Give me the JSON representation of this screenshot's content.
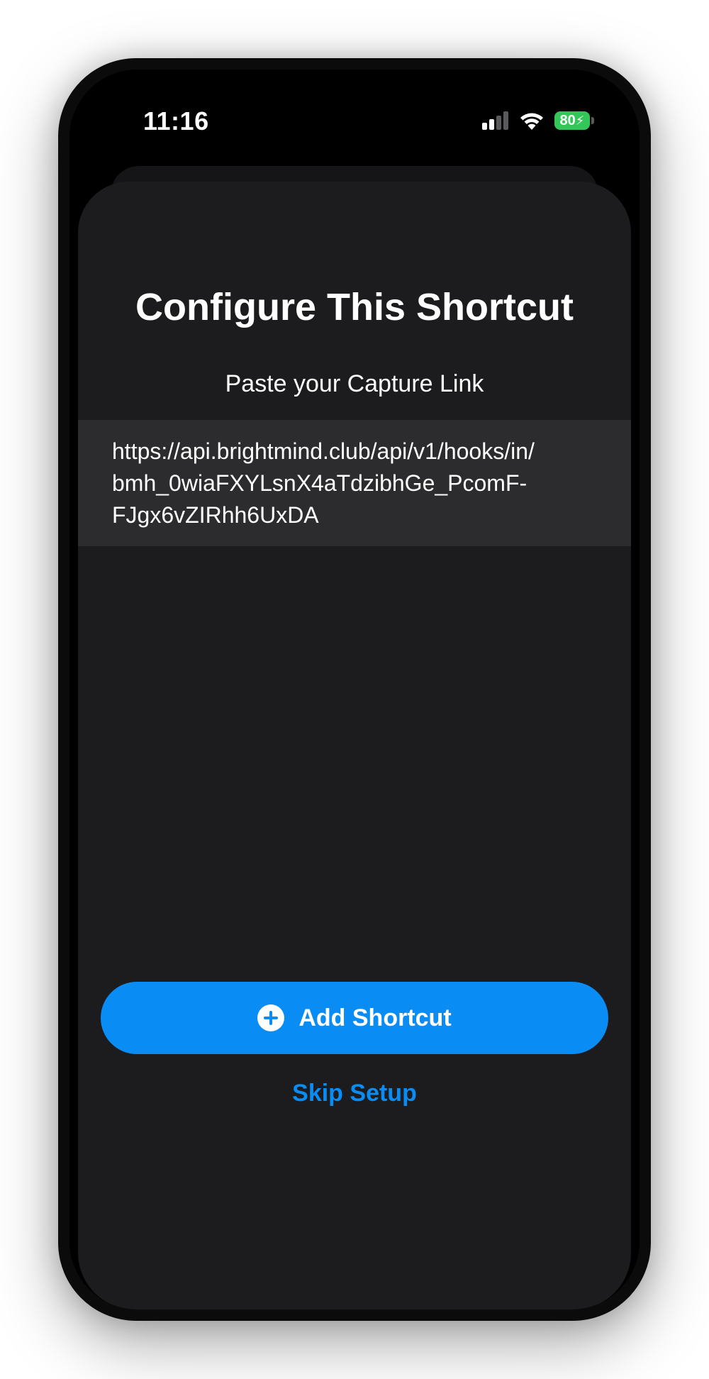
{
  "status_bar": {
    "time": "11:16",
    "battery_level": "80",
    "signal_icon": "cellular-signal-icon",
    "wifi_icon": "wifi-icon",
    "battery_icon": "battery-charging-icon",
    "battery_color": "#33c759"
  },
  "sheet": {
    "title": "Configure This Shortcut",
    "prompt": "Paste your Capture Link",
    "capture_link": "https://api.brightmind.club/api/v1/hooks/in/\nbmh_0wiaFXYLsnX4aTdzibhGe_PcomF-\nFJgx6vZIRhh6UxDA"
  },
  "actions": {
    "add_shortcut_label": "Add Shortcut",
    "add_icon": "plus-circle-icon",
    "skip_label": "Skip Setup",
    "accent_color": "#0a8cf5"
  }
}
